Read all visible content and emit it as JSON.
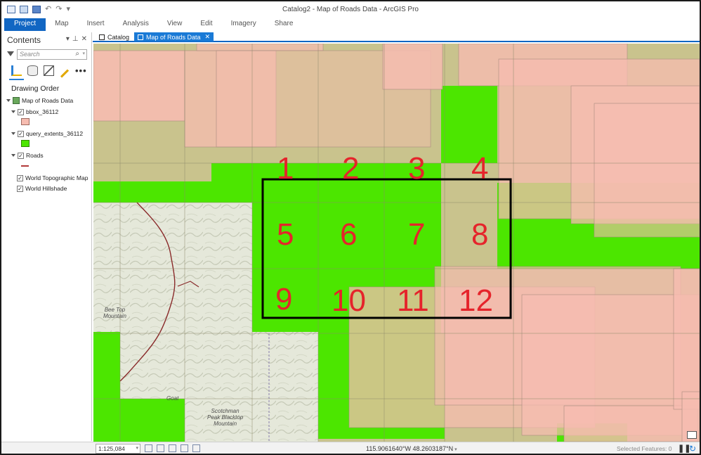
{
  "window": {
    "title": "Catalog2 - Map of Roads Data - ArcGIS Pro"
  },
  "ribbon": {
    "tabs": [
      "Project",
      "Map",
      "Insert",
      "Analysis",
      "View",
      "Edit",
      "Imagery",
      "Share"
    ],
    "active": "Project"
  },
  "contents": {
    "title": "Contents",
    "controls": [
      "▾",
      "⊥",
      "✕"
    ],
    "search_placeholder": "Search",
    "more_label": "•••",
    "drawing_order": "Drawing Order",
    "map_name": "Map of Roads Data",
    "layers": [
      {
        "name": "bbox_36112",
        "checked": true,
        "symbol_color": "#f6bcb0"
      },
      {
        "name": "query_extents_36112",
        "checked": true,
        "symbol_color": "#4ce600"
      },
      {
        "name": "Roads",
        "checked": true,
        "symbol_color": "#b23a3a"
      },
      {
        "name": "World Topographic Map",
        "checked": true
      },
      {
        "name": "World Hillshade",
        "checked": true
      }
    ]
  },
  "doc_tabs": {
    "catalog": "Catalog",
    "map": "Map of Roads Data",
    "close": "✕"
  },
  "map": {
    "grid_labels": [
      "1",
      "2",
      "3",
      "4",
      "5",
      "6",
      "7",
      "8",
      "9",
      "10",
      "11",
      "12"
    ],
    "topo_labels": {
      "bee_top": "Bee Top\nMountain",
      "scotchman": "Scotchman\nPeak Blacktop\nMountain",
      "goat": "Goat"
    },
    "colors": {
      "green": "#4ce600",
      "tan": "#c9c38d",
      "pink": "#f6bcb0",
      "topo": "#e4e7d9",
      "box": "#000000",
      "label": "#e5242b"
    }
  },
  "status": {
    "scale": "1:125,084",
    "coordinates": "115.9061640°W 48.2603187°N",
    "selected_features": "Selected Features: 0",
    "pause": "❚❚",
    "refresh": "↻"
  }
}
